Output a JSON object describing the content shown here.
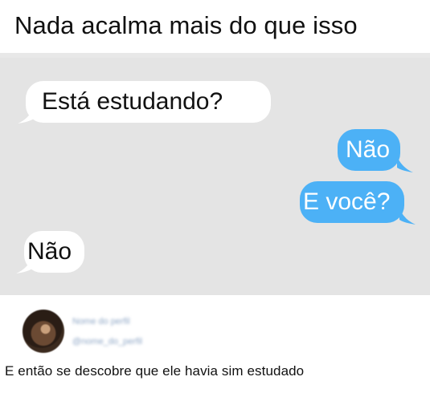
{
  "title": "Nada acalma mais do que isso",
  "chat": {
    "messages": [
      {
        "side": "incoming",
        "text": "Está estudando?"
      },
      {
        "side": "outgoing",
        "text": "Não"
      },
      {
        "side": "outgoing",
        "text": "E você?"
      },
      {
        "side": "incoming",
        "text": "Não"
      }
    ]
  },
  "post": {
    "author_line1": "Nome do perfil",
    "author_line2": "@nome_do_perfil",
    "caption": "E então se descobre que ele havia sim estudado"
  },
  "colors": {
    "chat_background": "#e4e4e4",
    "incoming_bubble": "#ffffff",
    "outgoing_bubble": "#4cb1f6"
  }
}
